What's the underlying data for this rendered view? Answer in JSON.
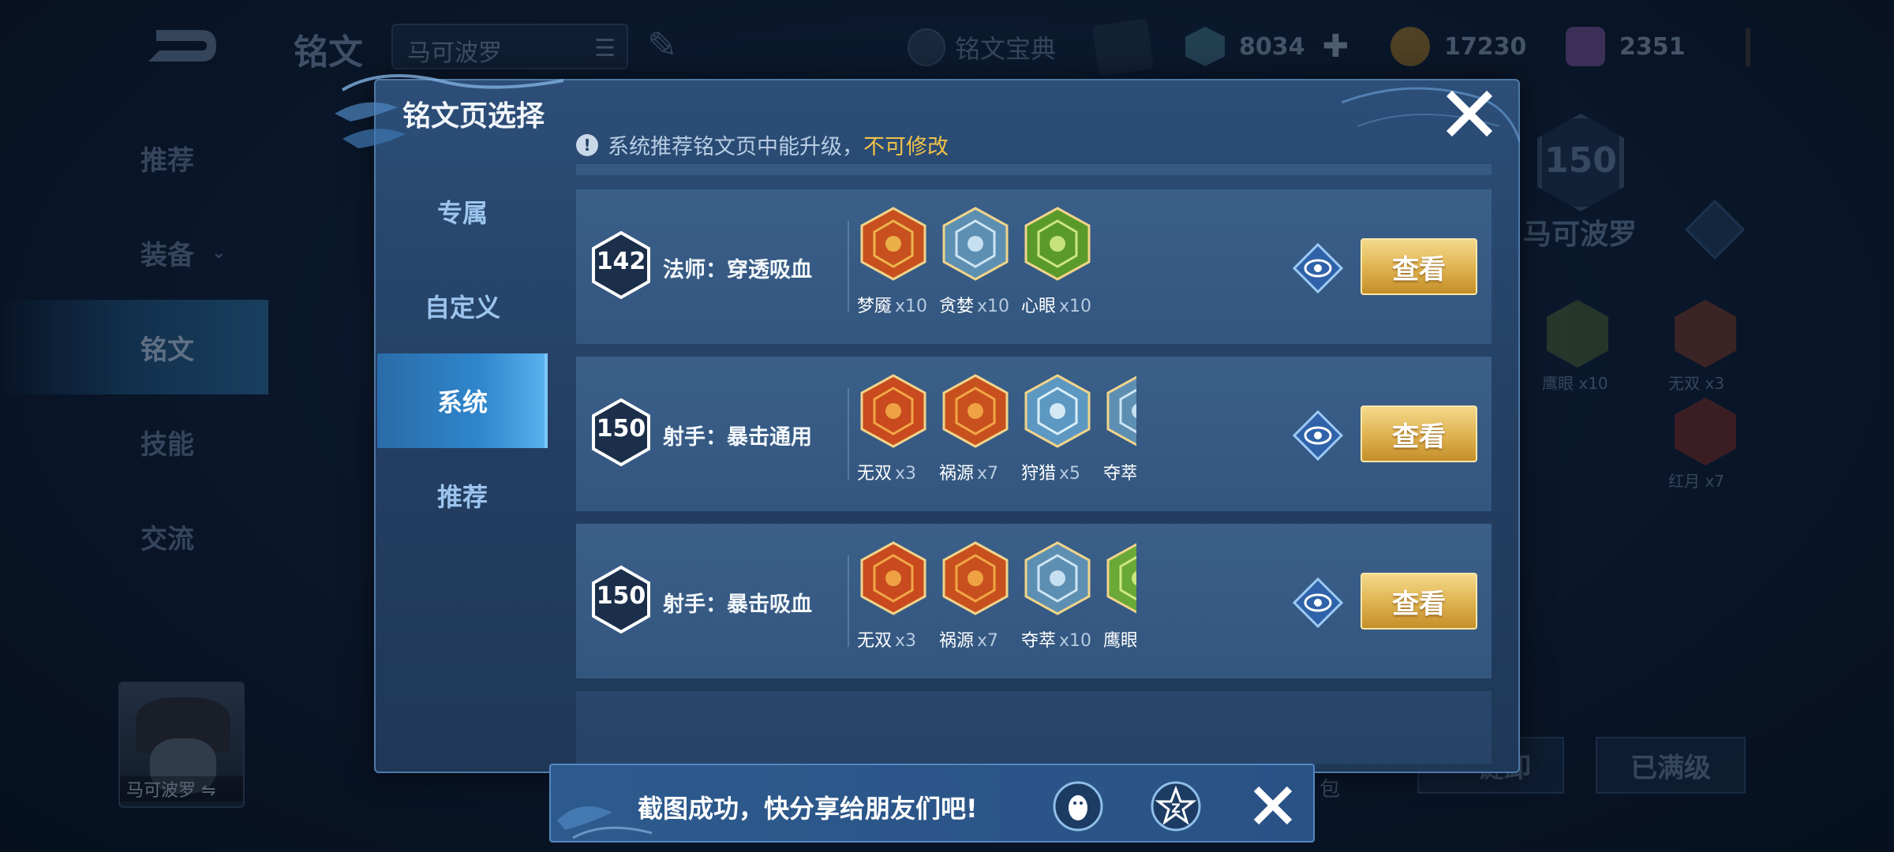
{
  "background": {
    "page_title": "铭文",
    "hero_select": "马可波罗",
    "codex_label": "铭文宝典",
    "currencies": [
      {
        "name": "hexagon-gem",
        "value": "8034"
      },
      {
        "name": "gold-coin",
        "value": "17230"
      },
      {
        "name": "purple-gem",
        "value": "2351"
      }
    ],
    "nav": [
      {
        "label": "推荐"
      },
      {
        "label": "装备"
      },
      {
        "label": "铭文"
      },
      {
        "label": "技能"
      },
      {
        "label": "交流"
      }
    ],
    "hero_card_name": "马可波罗",
    "hero_card_swap": "⇋",
    "rank_level": "150",
    "rank_hero_name": "马可波罗",
    "bg_runes": [
      {
        "label": "鹰眼 x10",
        "color": "#6a8c3a"
      },
      {
        "label": "无双 x3",
        "color": "#b4502a"
      },
      {
        "label": "红月 x7",
        "color": "#b43a2a"
      }
    ],
    "btn_unload": "一键卸",
    "btn_maxed": "已满级",
    "partial_text": "包"
  },
  "modal": {
    "title": "铭文页选择",
    "tabs": [
      {
        "label": "专属"
      },
      {
        "label": "自定义"
      },
      {
        "label": "系统"
      },
      {
        "label": "推荐"
      }
    ],
    "active_tab": "系统",
    "notice_text": "系统推荐铭文页中能升级，",
    "notice_warn": "不可修改",
    "view_label": "查看",
    "rows": [
      {
        "level": "142",
        "name": "法师：穿透吸血",
        "runes": [
          {
            "name": "梦魇",
            "count": "x10",
            "color": "#c8501e",
            "accent": "#f0c050"
          },
          {
            "name": "贪婪",
            "count": "x10",
            "color": "#5d8fb2",
            "accent": "#d9eefc"
          },
          {
            "name": "心眼",
            "count": "x10",
            "color": "#5a9a2a",
            "accent": "#d9f08a"
          }
        ]
      },
      {
        "level": "150",
        "name": "射手：暴击通用",
        "runes": [
          {
            "name": "无双",
            "count": "x3",
            "color": "#c84a1e",
            "accent": "#f5b04a"
          },
          {
            "name": "祸源",
            "count": "x7",
            "color": "#c8501e",
            "accent": "#f5b04a"
          },
          {
            "name": "狩猎",
            "count": "x5",
            "color": "#5d98c2",
            "accent": "#e8f8ff"
          },
          {
            "name": "夺萃",
            "count": "",
            "color": "#5d8fb2",
            "accent": "#d9eefc"
          }
        ]
      },
      {
        "level": "150",
        "name": "射手：暴击吸血",
        "runes": [
          {
            "name": "无双",
            "count": "x3",
            "color": "#c84a1e",
            "accent": "#f5b04a"
          },
          {
            "name": "祸源",
            "count": "x7",
            "color": "#c8501e",
            "accent": "#f5b04a"
          },
          {
            "name": "夺萃",
            "count": "x10",
            "color": "#5d8fb2",
            "accent": "#d9eefc"
          },
          {
            "name": "鹰眼",
            "count": "",
            "color": "#6aa838",
            "accent": "#d9f08a"
          }
        ]
      }
    ]
  },
  "toast": {
    "text": "截图成功，快分享给朋友们吧!"
  }
}
